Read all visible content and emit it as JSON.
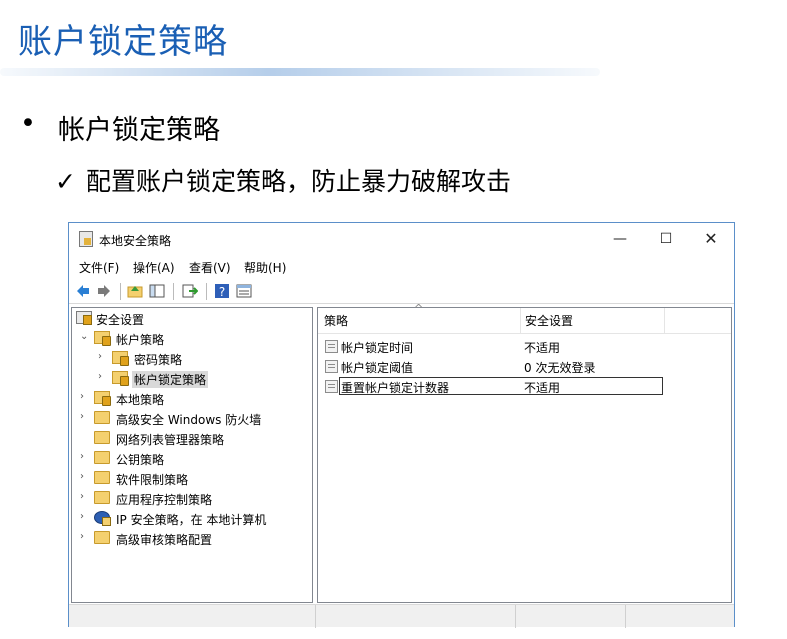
{
  "slide": {
    "title": "账户锁定策略",
    "bullet1": "帐户锁定策略",
    "bullet1_marker": "•",
    "bullet2": "配置账户锁定策略，防止暴力破解攻击",
    "bullet2_marker": "✓"
  },
  "window": {
    "title": "本地安全策略",
    "controls": {
      "minimize": "—",
      "maximize": "☐",
      "close": "✕"
    },
    "menu": [
      "文件(F)",
      "操作(A)",
      "查看(V)",
      "帮助(H)"
    ],
    "toolbar_icons": [
      "back-arrow-icon",
      "forward-arrow-icon",
      "up-folder-icon",
      "show-hide-tree-icon",
      "export-list-icon",
      "help-icon",
      "view-icon"
    ]
  },
  "tree": {
    "items": [
      {
        "label": "安全设置",
        "expander": "",
        "icon": "security-settings-icon"
      },
      {
        "label": "帐户策略",
        "expander": "⌄",
        "icon": "folder-lock-icon"
      },
      {
        "label": "密码策略",
        "expander": "›",
        "icon": "folder-lock-icon"
      },
      {
        "label": "帐户锁定策略",
        "expander": "›",
        "icon": "folder-lock-icon",
        "selected": true
      },
      {
        "label": "本地策略",
        "expander": "›",
        "icon": "folder-lock-icon"
      },
      {
        "label": "高级安全 Windows 防火墙",
        "expander": "›",
        "icon": "folder-icon"
      },
      {
        "label": "网络列表管理器策略",
        "expander": "",
        "icon": "folder-icon"
      },
      {
        "label": "公钥策略",
        "expander": "›",
        "icon": "folder-icon"
      },
      {
        "label": "软件限制策略",
        "expander": "›",
        "icon": "folder-icon"
      },
      {
        "label": "应用程序控制策略",
        "expander": "›",
        "icon": "folder-icon"
      },
      {
        "label": "IP 安全策略，在 本地计算机",
        "expander": "›",
        "icon": "ip-security-icon"
      },
      {
        "label": "高级审核策略配置",
        "expander": "›",
        "icon": "folder-icon"
      }
    ]
  },
  "list": {
    "columns": {
      "policy": "策略",
      "setting": "安全设置",
      "sort_indicator": "^"
    },
    "rows": [
      {
        "policy": "帐户锁定时间",
        "setting": "不适用"
      },
      {
        "policy": "帐户锁定阈值",
        "setting": "0 次无效登录"
      },
      {
        "policy": "重置帐户锁定计数器",
        "setting": "不适用"
      }
    ]
  },
  "colors": {
    "title_blue": "#1a5fb4",
    "window_border": "#5b8fc9",
    "selection": "#d9d9d9"
  }
}
